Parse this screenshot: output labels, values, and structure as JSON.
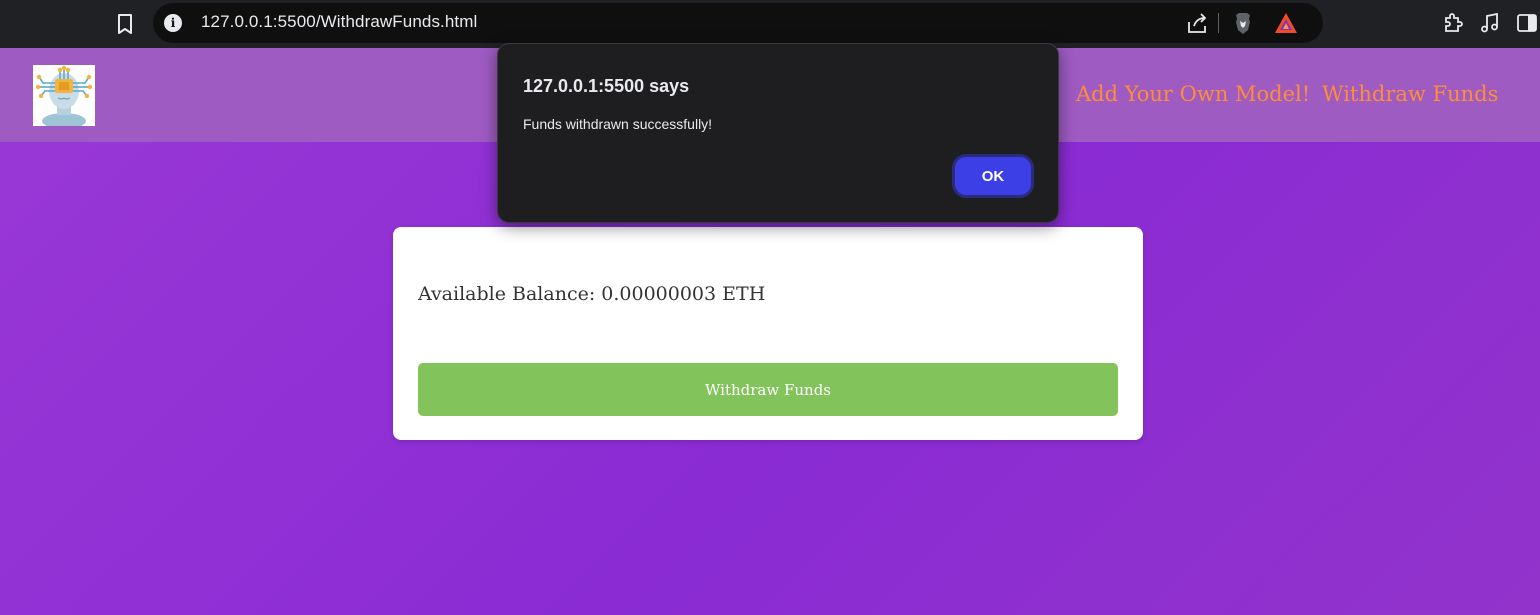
{
  "browser": {
    "url": "127.0.0.1:5500/WithdrawFunds.html",
    "icons": [
      "bookmark-icon",
      "site-info-icon",
      "share-icon",
      "brave-shields-icon",
      "brave-rewards-icon",
      "extensions-icon",
      "media-controls-icon",
      "sidebar-icon"
    ]
  },
  "navbar": {
    "logo": "ai-brain-logo",
    "links": [
      "Add Your Own Model!",
      "Withdraw Funds"
    ],
    "link_color": "#ff8c3a"
  },
  "card": {
    "balance_text": "Available Balance: 0.00000003 ETH",
    "withdraw_button": "Withdraw Funds",
    "button_color": "#82c35c"
  },
  "dialog": {
    "title": "127.0.0.1:5500 says",
    "message": "Funds withdrawn successfully!",
    "ok_button": "OK",
    "ok_color": "#3c3ee6"
  },
  "colors": {
    "page_background": "#8e2ed0",
    "navbar": "#9e5bc2"
  }
}
